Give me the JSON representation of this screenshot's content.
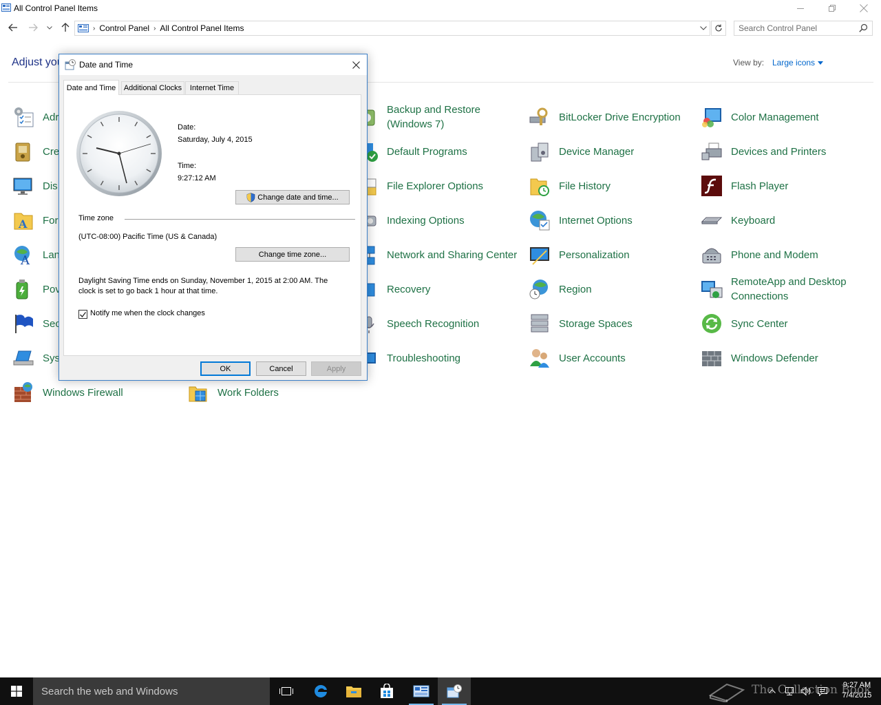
{
  "window": {
    "title": "All Control Panel Items"
  },
  "address_bar": {
    "crumbs": [
      "Control Panel",
      "All Control Panel Items"
    ]
  },
  "search": {
    "placeholder": "Search Control Panel"
  },
  "header": {
    "adjust_text": "Adjust you",
    "view_by_label": "View by:",
    "view_by_value": "Large icons"
  },
  "items": [
    {
      "label": "Adr",
      "icon": "administrative-tools-icon"
    },
    {
      "label": "Cre",
      "icon": "credential-manager-icon"
    },
    {
      "label": "Dis",
      "icon": "display-icon"
    },
    {
      "label": "For",
      "icon": "fonts-icon"
    },
    {
      "label": "Lan",
      "icon": "language-icon"
    },
    {
      "label": "Pov",
      "icon": "power-options-icon"
    },
    {
      "label": "Sec",
      "icon": "security-maintenance-icon"
    },
    {
      "label": "Sys",
      "icon": "system-icon"
    },
    {
      "label": "Windows Firewall",
      "icon": "firewall-icon"
    },
    {
      "label": "Work Folders",
      "icon": "work-folders-icon"
    },
    {
      "label": "Backup and Restore (Windows 7)",
      "icon": "backup-restore-icon"
    },
    {
      "label": "Default Programs",
      "icon": "default-programs-icon"
    },
    {
      "label": "File Explorer Options",
      "icon": "file-explorer-options-icon"
    },
    {
      "label": "Indexing Options",
      "icon": "indexing-options-icon"
    },
    {
      "label": "Network and Sharing Center",
      "icon": "network-sharing-icon"
    },
    {
      "label": "Recovery",
      "icon": "recovery-icon"
    },
    {
      "label": "Speech Recognition",
      "icon": "speech-recognition-icon"
    },
    {
      "label": "Troubleshooting",
      "icon": "troubleshooting-icon"
    },
    {
      "label": "BitLocker Drive Encryption",
      "icon": "bitlocker-icon"
    },
    {
      "label": "Device Manager",
      "icon": "device-manager-icon"
    },
    {
      "label": "File History",
      "icon": "file-history-icon"
    },
    {
      "label": "Internet Options",
      "icon": "internet-options-icon"
    },
    {
      "label": "Personalization",
      "icon": "personalization-icon"
    },
    {
      "label": "Region",
      "icon": "region-icon"
    },
    {
      "label": "Storage Spaces",
      "icon": "storage-spaces-icon"
    },
    {
      "label": "User Accounts",
      "icon": "user-accounts-icon"
    },
    {
      "label": "Color Management",
      "icon": "color-management-icon"
    },
    {
      "label": "Devices and Printers",
      "icon": "devices-printers-icon"
    },
    {
      "label": "Flash Player",
      "icon": "flash-player-icon"
    },
    {
      "label": "Keyboard",
      "icon": "keyboard-icon"
    },
    {
      "label": "Phone and Modem",
      "icon": "phone-modem-icon"
    },
    {
      "label": "RemoteApp and Desktop Connections",
      "icon": "remoteapp-icon"
    },
    {
      "label": "Sync Center",
      "icon": "sync-center-icon"
    },
    {
      "label": "Windows Defender",
      "icon": "windows-defender-icon"
    }
  ],
  "dialog": {
    "title": "Date and Time",
    "tabs": [
      "Date and Time",
      "Additional Clocks",
      "Internet Time"
    ],
    "date_label": "Date:",
    "date_value": "Saturday, July 4, 2015",
    "time_label": "Time:",
    "time_value": "9:27:12 AM",
    "change_datetime_button": "Change date and time...",
    "timezone_group": "Time zone",
    "timezone_value": "(UTC-08:00) Pacific Time (US & Canada)",
    "change_timezone_button": "Change time zone...",
    "dst_line1": "Daylight Saving Time ends on Sunday, November 1, 2015 at 2:00 AM. The",
    "dst_line2": "clock is set to go back 1 hour at that time.",
    "notify_label": "Notify me when the clock changes",
    "notify_checked": true,
    "ok_button": "OK",
    "cancel_button": "Cancel",
    "apply_button": "Apply"
  },
  "taskbar": {
    "search_placeholder": "Search the web and Windows",
    "clock_time": "9:27 AM",
    "clock_date": "7/4/2015",
    "watermark": "The Collection Book"
  },
  "colors": {
    "item_text": "#1e7145",
    "link_blue": "#0066cc",
    "header_blue": "#1e3287",
    "dialog_border": "#3c7fc7",
    "taskbar": "#101010"
  }
}
